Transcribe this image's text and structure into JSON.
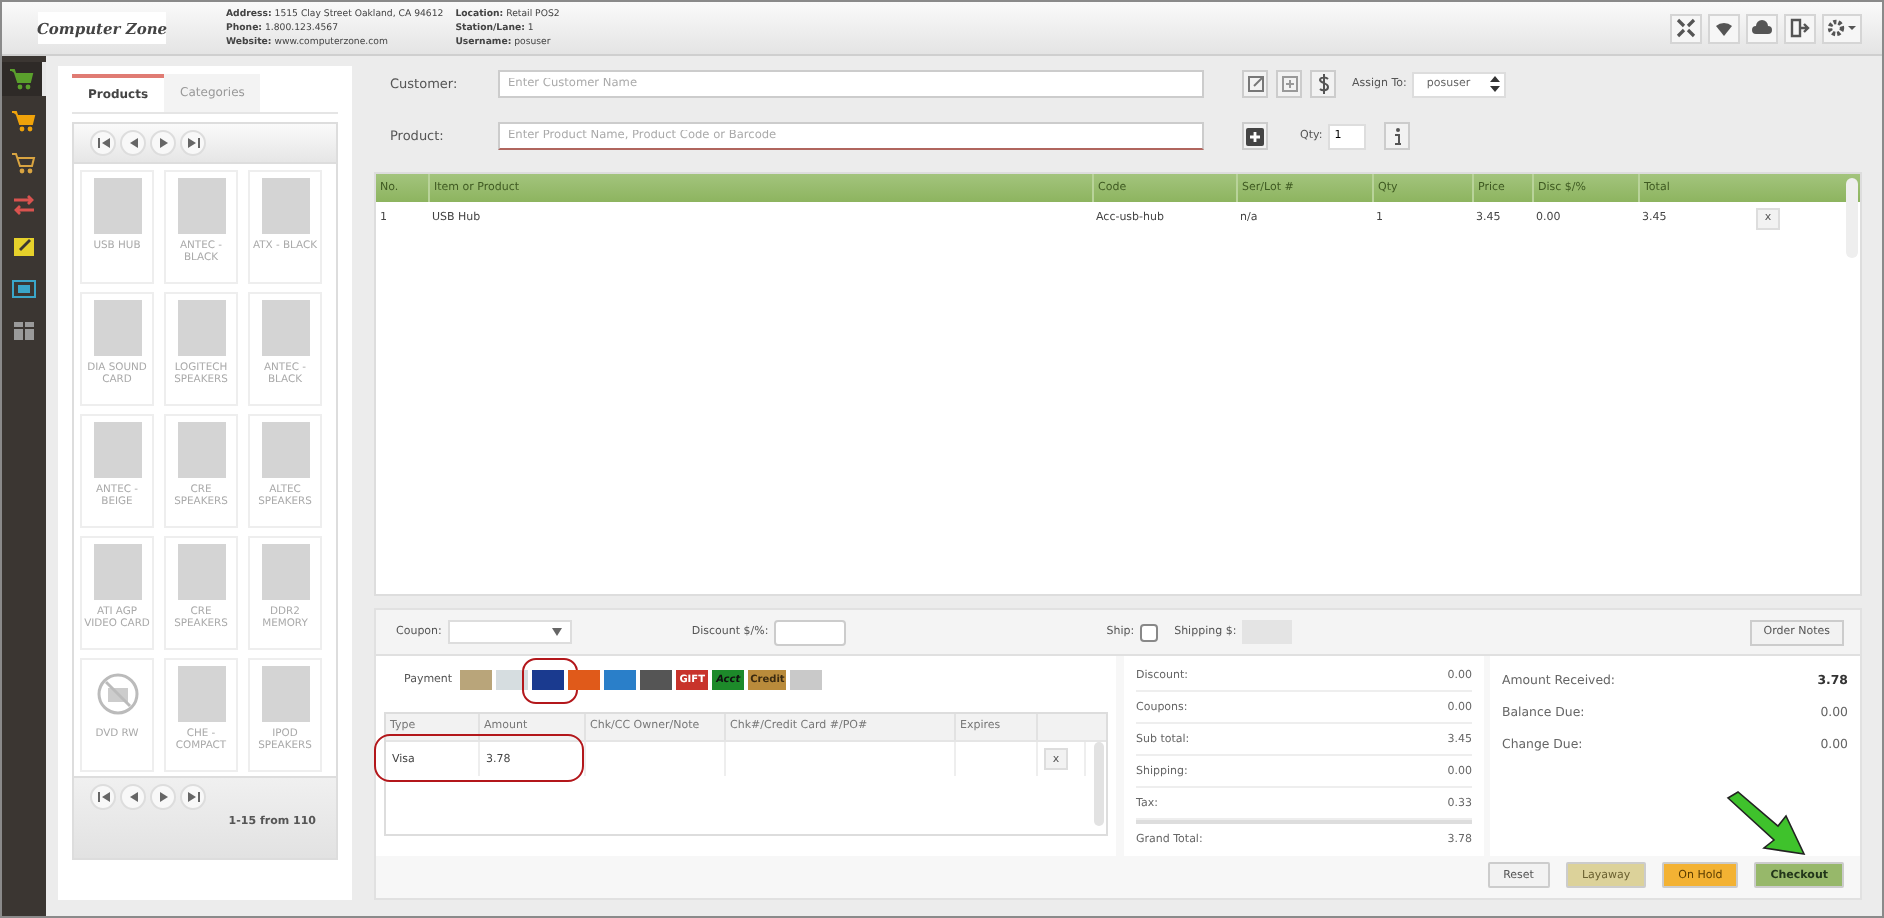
{
  "header": {
    "logo": "Computer Zone",
    "info": [
      {
        "label": "Address:",
        "value": "1515 Clay Street Oakland, CA 94612"
      },
      {
        "label": "Phone:",
        "value": "1.800.123.4567"
      },
      {
        "label": "Website:",
        "value": "www.computerzone.com"
      }
    ],
    "info2": [
      {
        "label": "Location:",
        "value": "Retail POS2"
      },
      {
        "label": "Station/Lane:",
        "value": "1"
      },
      {
        "label": "Username:",
        "value": "posuser"
      }
    ]
  },
  "sidebar": {
    "items": [
      {
        "kind": "cart",
        "color": "#5aa02c",
        "selected": true
      },
      {
        "kind": "cart",
        "color": "#f0a30a",
        "selected": false
      },
      {
        "kind": "cart-outline",
        "color": "#d9a441",
        "selected": false
      },
      {
        "kind": "swap",
        "color": "#d9534f",
        "selected": false
      },
      {
        "kind": "edit",
        "color": "#e6d12b",
        "selected": false
      },
      {
        "kind": "screen",
        "color": "#3aa6c9",
        "selected": false
      },
      {
        "kind": "table",
        "color": "#9a9a9a",
        "selected": false
      }
    ]
  },
  "catalog": {
    "tabs": [
      {
        "label": "Products",
        "selected": true
      },
      {
        "label": "Categories",
        "selected": false
      }
    ],
    "products": [
      {
        "name": "USB HUB",
        "kind": "photo"
      },
      {
        "name": "ANTEC - BLACK",
        "kind": "photo"
      },
      {
        "name": "ATX - BLACK",
        "kind": "photo"
      },
      {
        "name": "DIA SOUND CARD",
        "kind": "photo"
      },
      {
        "name": "LOGITECH SPEAKERS",
        "kind": "photo"
      },
      {
        "name": "ANTEC - BLACK",
        "kind": "photo"
      },
      {
        "name": "ANTEC - BEIGE",
        "kind": "photo"
      },
      {
        "name": "CRE SPEAKERS",
        "kind": "photo"
      },
      {
        "name": "ALTEC SPEAKERS",
        "kind": "photo"
      },
      {
        "name": "ATI AGP VIDEO CARD",
        "kind": "photo"
      },
      {
        "name": "CRE SPEAKERS",
        "kind": "photo"
      },
      {
        "name": "DDR2 MEMORY",
        "kind": "photo"
      },
      {
        "name": "DVD RW",
        "kind": "no-image"
      },
      {
        "name": "CHE - COMPACT",
        "kind": "photo"
      },
      {
        "name": "IPOD SPEAKERS",
        "kind": "photo"
      }
    ],
    "pager": "1-15 from 110"
  },
  "order": {
    "customer_label": "Customer:",
    "customer_placeholder": "Enter Customer Name",
    "assign_label": "Assign To:",
    "assign_value": "posuser",
    "product_label": "Product:",
    "product_placeholder": "Enter Product Name, Product Code or Barcode",
    "qty_label": "Qty:",
    "qty_value": "1"
  },
  "items_table": {
    "columns": [
      "No.",
      "Item or Product",
      "Code",
      "Ser/Lot #",
      "Qty",
      "Price",
      "Disc $/%",
      "Total"
    ],
    "rows": [
      {
        "cells": [
          "1",
          "USB Hub",
          "Acc-usb-hub",
          "n/a",
          "1",
          "3.45",
          "0.00",
          "3.45"
        ],
        "remove": "x"
      }
    ]
  },
  "adjust": {
    "coupon_label": "Coupon:",
    "discount_label": "Discount $/%:",
    "ship_label": "Ship:",
    "ship_checked": false,
    "shipping_label": "Shipping $:",
    "notes_button": "Order Notes"
  },
  "payment": {
    "label": "Payment",
    "methods": [
      {
        "kind": "cash",
        "highlighted": false
      },
      {
        "kind": "check",
        "highlighted": false
      },
      {
        "kind": "visa",
        "highlighted": true
      },
      {
        "kind": "mastercard",
        "highlighted": false
      },
      {
        "kind": "amex",
        "highlighted": false
      },
      {
        "kind": "swipe",
        "highlighted": false
      },
      {
        "kind": "gift",
        "label": "GIFT",
        "highlighted": false
      },
      {
        "kind": "acct",
        "label": "Acct",
        "highlighted": false
      },
      {
        "kind": "credit",
        "label": "Credit",
        "highlighted": false
      },
      {
        "kind": "note",
        "highlighted": false
      }
    ],
    "columns": [
      "Type",
      "Amount",
      "Chk/CC Owner/Note",
      "Chk#/Credit Card #/PO#",
      "Expires"
    ],
    "rows": [
      {
        "cells": [
          "Visa",
          "3.78"
        ],
        "remove": "x",
        "highlighted": true
      }
    ]
  },
  "totals": [
    {
      "label": "Discount:",
      "value": "0.00"
    },
    {
      "label": "Coupons:",
      "value": "0.00"
    },
    {
      "label": "Sub total:",
      "value": "3.45"
    },
    {
      "label": "Shipping:",
      "value": "0.00"
    },
    {
      "label": "Tax:",
      "value": "0.33"
    },
    {
      "label": "Grand Total:",
      "value": "3.78"
    }
  ],
  "amounts": [
    {
      "label": "Amount Received:",
      "value": "3.78",
      "bold": true
    },
    {
      "label": "Balance Due:",
      "value": "0.00",
      "bold": false
    },
    {
      "label": "Change Due:",
      "value": "0.00",
      "bold": false
    }
  ],
  "actions": [
    {
      "label": "Reset",
      "kind": "default",
      "pointer": false
    },
    {
      "label": "Layaway",
      "kind": "layaway",
      "pointer": false
    },
    {
      "label": "On Hold",
      "kind": "hold",
      "pointer": false
    },
    {
      "label": "Checkout",
      "kind": "checkout",
      "pointer": true
    }
  ]
}
